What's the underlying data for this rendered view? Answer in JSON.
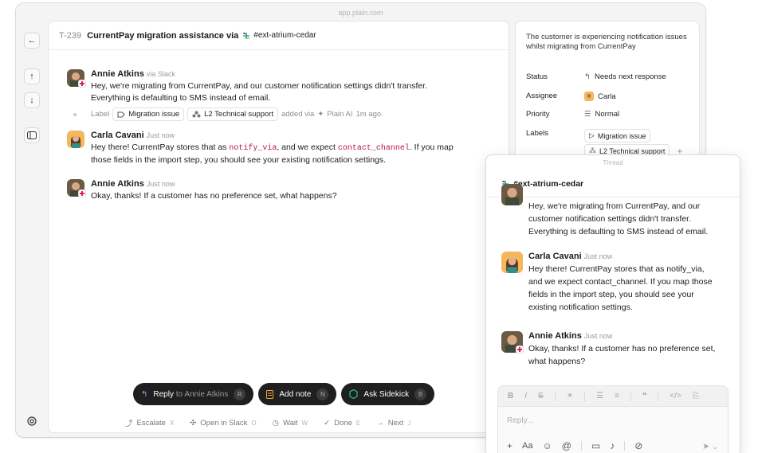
{
  "window": {
    "url": "app.plain.com"
  },
  "ticket": {
    "id": "T-239",
    "title": "CurrentPay migration assistance via",
    "channel": "#ext-atrium-cedar"
  },
  "messages": [
    {
      "author": "Annie Atkins",
      "via": "via Slack",
      "lines": [
        "Hey, we're migrating from CurrentPay, and our customer notification settings didn't transfer.",
        "Everything is defaulting to SMS instead of email."
      ]
    },
    {
      "author": "Carla Cavani",
      "via": "Just now",
      "line1_pre": "Hey there! CurrentPay stores that as ",
      "code1": "notify_via",
      "line1_mid": ", and we expect ",
      "code2": "contact_channel",
      "line1_post": ". If you map",
      "line2": "those fields in the import step, you should see your existing notification settings."
    },
    {
      "author": "Annie Atkins",
      "via": "Just now",
      "lines": [
        "Okay, thanks! If a customer has no preference set, what happens?"
      ]
    }
  ],
  "label_event": {
    "prefix": "Label",
    "chip1": "Migration issue",
    "chip2": "L2 Technical support",
    "added_via": "added via",
    "agent": "Plain AI",
    "time": "1m ago"
  },
  "actions": [
    {
      "label": "Reply",
      "suffix": "to Annie Atkins",
      "key": "R"
    },
    {
      "label": "Add note",
      "key": "N"
    },
    {
      "label": "Ask Sidekick",
      "key": "B"
    }
  ],
  "bottom": [
    {
      "label": "Escalate",
      "key": "X"
    },
    {
      "label": "Open in Slack",
      "key": "O"
    },
    {
      "label": "Wait",
      "key": "W"
    },
    {
      "label": "Done",
      "key": "E"
    },
    {
      "label": "Next",
      "key": "J"
    }
  ],
  "side": {
    "summary": "The customer is experiencing notification issues whilst migrating from CurrentPay",
    "status_key": "Status",
    "status_val": "Needs next response",
    "assignee_key": "Assignee",
    "assignee_val": "Carla",
    "priority_key": "Priority",
    "priority_val": "Normal",
    "labels_key": "Labels",
    "label1": "Migration issue",
    "label2": "L2 Technical support"
  },
  "thread": {
    "top": "Thread",
    "channel": "#ext-atrium-cedar",
    "m1_lines": [
      "Hey, we're migrating from CurrentPay, and our",
      "customer notification settings didn't transfer.",
      "Everything is defaulting to SMS instead of email."
    ],
    "m2_author": "Carla Cavani",
    "m2_time": "Just now",
    "m2_lines": [
      "Hey there! CurrentPay stores that as notify_via,",
      "and we expect contact_channel. If you map those",
      "fields in the import step, you should see your",
      "existing notification settings."
    ],
    "m3_author": "Annie Atkins",
    "m3_time": "Just now",
    "m3_lines": [
      "Okay, thanks! If a customer has no preference set,",
      "what happens?"
    ],
    "reply_placeholder": "Reply..."
  },
  "colors": {
    "accent_dark": "#1f1f1f",
    "code": "#b5174a",
    "sidekick": "#2bb673",
    "note": "#f2a33a"
  }
}
